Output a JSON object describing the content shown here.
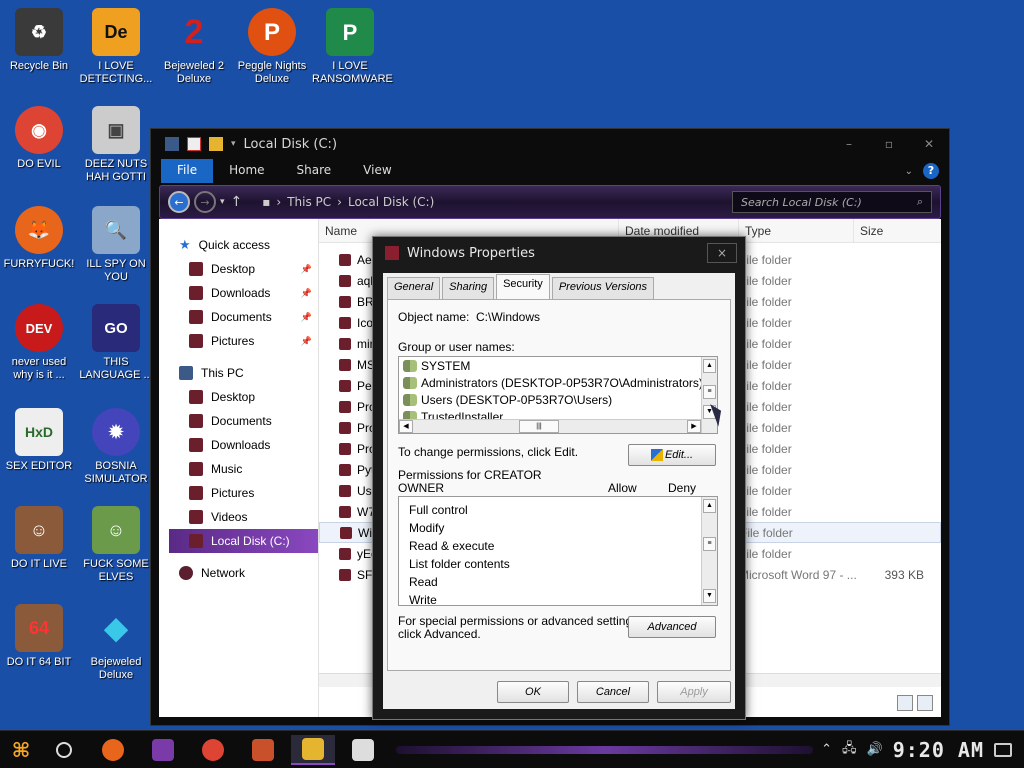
{
  "desktop": {
    "icons": [
      {
        "label": "Recycle Bin",
        "color": "#3a3a3a",
        "glyph": "♻"
      },
      {
        "label": "I LOVE DETECTING...",
        "color": "#f0a020",
        "glyph": "De"
      },
      {
        "label": "Bejeweled 2 Deluxe",
        "color": "#b01818",
        "glyph": "2"
      },
      {
        "label": "Peggle Nights Deluxe",
        "color": "#e05010",
        "glyph": "P"
      },
      {
        "label": "I LOVE RANSOMWARE",
        "color": "#1f8a4a",
        "glyph": "P"
      },
      {
        "label": "DO EVIL",
        "color": "#dd4433",
        "glyph": "◉"
      },
      {
        "label": "DEEZ NUTS HAH GOTTI",
        "color": "#cccccc",
        "glyph": "▣"
      },
      {
        "label": "FURRYFUCK!",
        "color": "#e8651c",
        "glyph": "🦊"
      },
      {
        "label": "ILL SPY ON YOU",
        "color": "#8aa6c8",
        "glyph": "🔍"
      },
      {
        "label": "never used why is it ...",
        "color": "#c81a1a",
        "glyph": "DEV"
      },
      {
        "label": "THIS LANGUAGE ...",
        "color": "#2a2a7a",
        "glyph": "GO"
      },
      {
        "label": "SEX EDITOR",
        "color": "#eeeeee",
        "glyph": "HxD"
      },
      {
        "label": "BOSNIA SIMULATOR",
        "color": "#4444bb",
        "glyph": "✹"
      },
      {
        "label": "DO IT LIVE",
        "color": "#8a5a3a",
        "glyph": "☺"
      },
      {
        "label": "FUCK SOME ELVES",
        "color": "#6a9a4a",
        "glyph": "☺"
      },
      {
        "label": "DO IT 64 BIT",
        "color": "#8a5a3a",
        "glyph": "64"
      },
      {
        "label": "Bejeweled Deluxe",
        "color": "#3ac8e8",
        "glyph": "◆"
      }
    ]
  },
  "explorer": {
    "title": "Local Disk (C:)",
    "ribbon_tabs": [
      "File",
      "Home",
      "Share",
      "View"
    ],
    "breadcrumbs": [
      "This PC",
      "Local Disk (C:)"
    ],
    "search_placeholder": "Search Local Disk (C:)",
    "columns": [
      "Name",
      "Date modified",
      "Type",
      "Size"
    ],
    "nav": {
      "quick_access": "Quick access",
      "quick_items": [
        "Desktop",
        "Downloads",
        "Documents",
        "Pictures"
      ],
      "this_pc": "This PC",
      "pc_items": [
        "Desktop",
        "Documents",
        "Downloads",
        "Music",
        "Pictures",
        "Videos"
      ],
      "selected": "Local Disk (C:)",
      "network": "Network"
    },
    "files": [
      {
        "name": "Aer",
        "type": "File folder",
        "size": ""
      },
      {
        "name": "aqk",
        "type": "File folder",
        "size": ""
      },
      {
        "name": "BRI",
        "type": "File folder",
        "size": ""
      },
      {
        "name": "Ico",
        "type": "File folder",
        "size": ""
      },
      {
        "name": "min",
        "type": "File folder",
        "size": ""
      },
      {
        "name": "MS(",
        "type": "File folder",
        "size": ""
      },
      {
        "name": "Per",
        "type": "File folder",
        "size": ""
      },
      {
        "name": "Pro",
        "type": "File folder",
        "size": ""
      },
      {
        "name": "Pro",
        "type": "File folder",
        "size": ""
      },
      {
        "name": "Pro",
        "type": "File folder",
        "size": ""
      },
      {
        "name": "Pyt",
        "type": "File folder",
        "size": ""
      },
      {
        "name": "Use",
        "type": "File folder",
        "size": ""
      },
      {
        "name": "W7",
        "type": "File folder",
        "size": ""
      },
      {
        "name": "Win",
        "type": "File folder",
        "size": ""
      },
      {
        "name": "yEc",
        "type": "File folder",
        "size": ""
      },
      {
        "name": "SFK",
        "type": "Microsoft Word 97 - ...",
        "size": "393 KB"
      }
    ]
  },
  "dialog": {
    "title": "Windows Properties",
    "close": "×",
    "tabs": [
      "General",
      "Sharing",
      "Security",
      "Previous Versions"
    ],
    "object_name_label": "Object name:",
    "object_name_value": "C:\\Windows",
    "group_label": "Group or user names:",
    "groups": [
      "SYSTEM",
      "Administrators (DESKTOP-0P53R7O\\Administrators)",
      "Users (DESKTOP-0P53R7O\\Users)",
      "TrustedInstaller"
    ],
    "change_text": "To change permissions, click Edit.",
    "edit_button": "Edit...",
    "perm_label_1": "Permissions for CREATOR",
    "perm_label_2": "OWNER",
    "allow": "Allow",
    "deny": "Deny",
    "permissions": [
      "Full control",
      "Modify",
      "Read & execute",
      "List folder contents",
      "Read",
      "Write"
    ],
    "special_text_1": "For special permissions or advanced settings,",
    "special_text_2": "click Advanced.",
    "advanced_button": "Advanced",
    "ok": "OK",
    "cancel": "Cancel",
    "apply": "Apply"
  },
  "taskbar": {
    "clock": "9:20 AM",
    "apps": [
      {
        "name": "firefox",
        "color": "#e8651c"
      },
      {
        "name": "purple-app",
        "color": "#7a3aa8"
      },
      {
        "name": "chrome",
        "color": "#dd4433"
      },
      {
        "name": "powerpoint",
        "color": "#c8502a"
      },
      {
        "name": "file-explorer",
        "color": "#e6b530"
      },
      {
        "name": "hxd",
        "color": "#dddddd"
      }
    ]
  }
}
